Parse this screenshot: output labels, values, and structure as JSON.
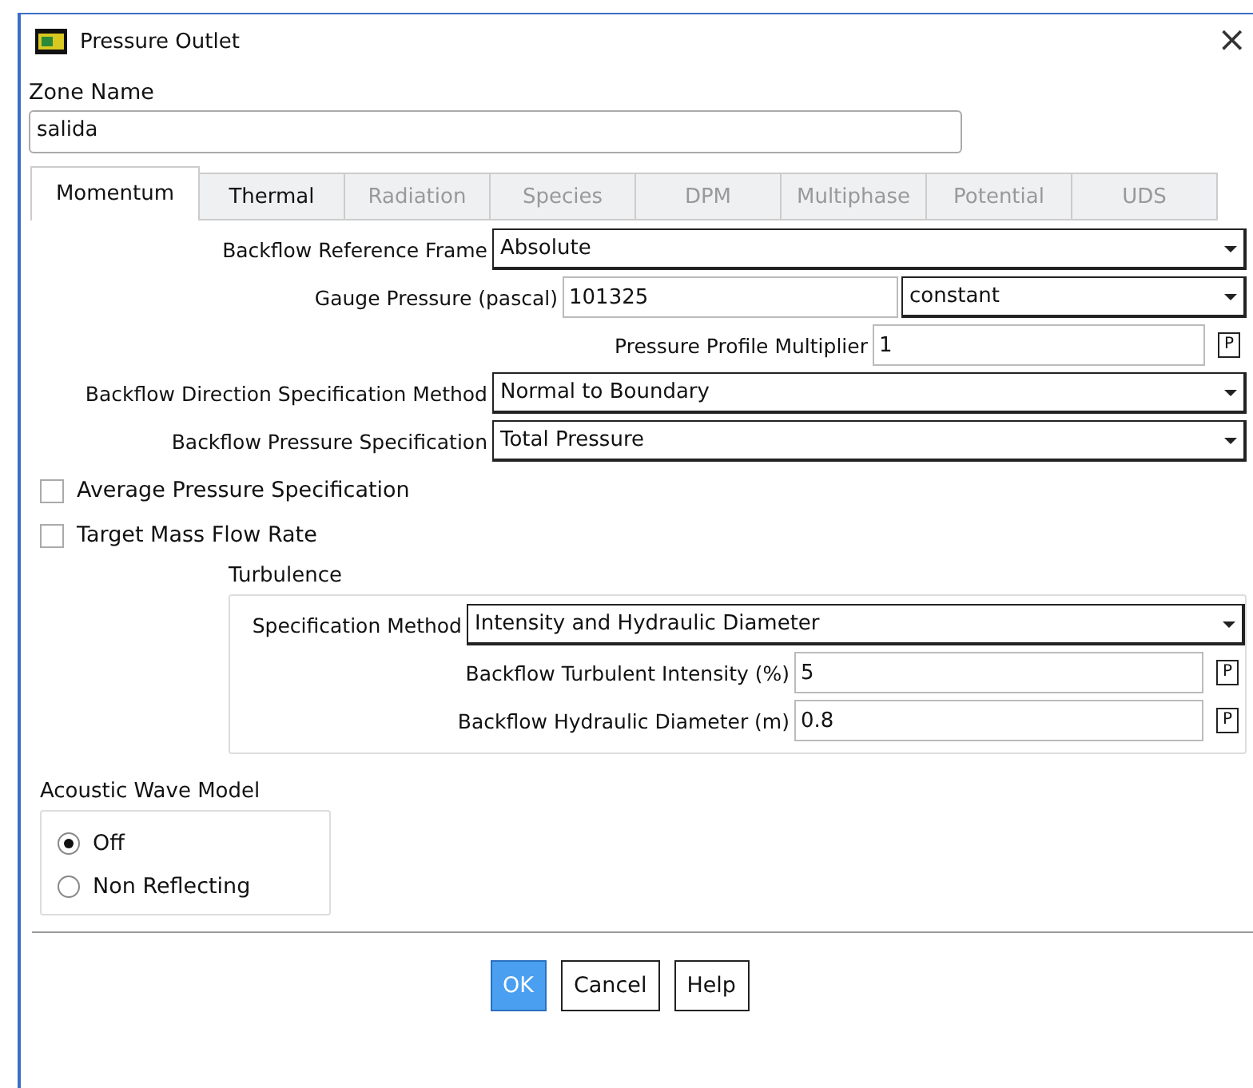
{
  "window": {
    "title": "Pressure Outlet",
    "close": "×"
  },
  "zone_name": {
    "label": "Zone Name",
    "value": "salida"
  },
  "tabs": [
    {
      "label": "Momentum",
      "selected": true,
      "disabled": false
    },
    {
      "label": "Thermal",
      "selected": false,
      "disabled": false
    },
    {
      "label": "Radiation",
      "selected": false,
      "disabled": true
    },
    {
      "label": "Species",
      "selected": false,
      "disabled": true
    },
    {
      "label": "DPM",
      "selected": false,
      "disabled": true
    },
    {
      "label": "Multiphase",
      "selected": false,
      "disabled": true
    },
    {
      "label": "Potential",
      "selected": false,
      "disabled": true
    },
    {
      "label": "UDS",
      "selected": false,
      "disabled": true
    }
  ],
  "momentum": {
    "backflow_reference_frame": {
      "label": "Backflow Reference Frame",
      "value": "Absolute"
    },
    "gauge_pressure": {
      "label": "Gauge Pressure (pascal)",
      "value": "101325",
      "profile": "constant"
    },
    "pressure_profile_multiplier": {
      "label": "Pressure Profile Multiplier",
      "value": "1",
      "param": "P"
    },
    "backflow_direction": {
      "label": "Backflow Direction Specification Method",
      "value": "Normal to Boundary"
    },
    "backflow_pressure": {
      "label": "Backflow Pressure Specification",
      "value": "Total Pressure"
    },
    "checkboxes": [
      {
        "label": "Average Pressure Specification",
        "checked": false
      },
      {
        "label": "Target Mass Flow Rate",
        "checked": false
      }
    ],
    "turbulence": {
      "title": "Turbulence",
      "specification_method": {
        "label": "Specification Method",
        "value": "Intensity and Hydraulic Diameter"
      },
      "fields": [
        {
          "label": "Backflow Turbulent Intensity (%)",
          "value": "5",
          "param": "P"
        },
        {
          "label": "Backflow Hydraulic Diameter (m)",
          "value": "0.8",
          "param": "P"
        }
      ]
    }
  },
  "acoustic_wave_model": {
    "title": "Acoustic Wave Model",
    "options": [
      {
        "label": "Off",
        "selected": true
      },
      {
        "label": "Non Reflecting",
        "selected": false
      }
    ]
  },
  "buttons": [
    {
      "label": "OK",
      "default": true
    },
    {
      "label": "Cancel",
      "default": false
    },
    {
      "label": "Help",
      "default": false
    }
  ]
}
